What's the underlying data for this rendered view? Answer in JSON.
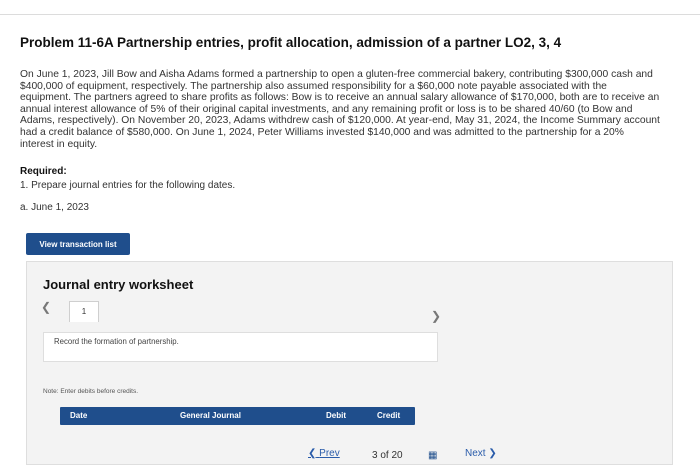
{
  "problem": {
    "title": "Problem 11-6A Partnership entries, profit allocation, admission of a partner LO2, 3, 4",
    "description": "On June 1, 2023, Jill Bow and Aisha Adams formed a partnership to open a gluten-free commercial bakery, contributing $300,000 cash and $400,000 of equipment, respectively. The partnership also assumed responsibility for a $60,000 note payable associated with the equipment. The partners agreed to share profits as follows: Bow is to receive an annual salary allowance of $170,000, both are to receive an annual interest allowance of 5% of their original capital investments, and any remaining profit or loss is to be shared 40/60 (to Bow and Adams, respectively). On November 20, 2023, Adams withdrew cash of $120,000. At year-end, May 31, 2024, the Income Summary account had a credit balance of $580,000. On June 1, 2024, Peter Williams invested $140,000 and was admitted to the partnership for a 20% interest in equity.",
    "required_label": "Required:",
    "requirement_1": "1. Prepare journal entries for the following dates.",
    "sub_a": "a. June 1, 2023"
  },
  "buttons": {
    "view_transaction_list": "View transaction list",
    "prev": "Prev",
    "next": "Next"
  },
  "worksheet": {
    "title": "Journal entry worksheet",
    "current_step": "1",
    "instruction": "Record the formation of partnership.",
    "note": "Note: Enter debits before credits.",
    "columns": [
      "Date",
      "General Journal",
      "Debit",
      "Credit"
    ]
  },
  "pagination": {
    "current": "3",
    "of_label": "of",
    "total": "20"
  },
  "colors": {
    "accent": "#1f4e8c",
    "link": "#2a5caa"
  }
}
